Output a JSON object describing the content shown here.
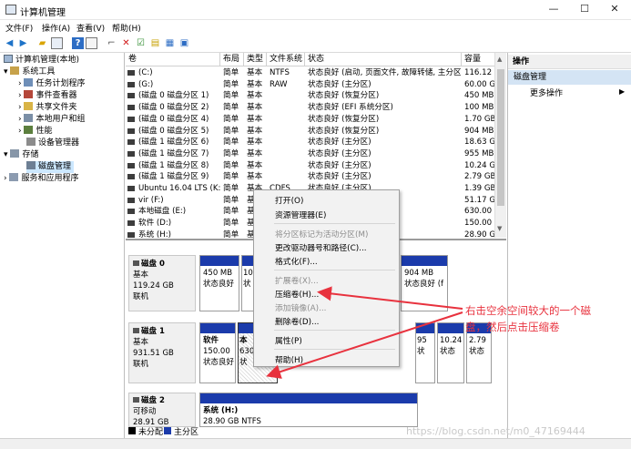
{
  "window": {
    "title": "计算机管理",
    "controls": [
      "—",
      "☐",
      "✕"
    ]
  },
  "menu": [
    "文件(F)",
    "操作(A)",
    "查看(V)",
    "帮助(H)"
  ],
  "toolbar_icons": [
    "back-icon",
    "forward-icon",
    "folder-up-icon",
    "console-tree-icon",
    "help-icon",
    "properties-icon",
    "connect-icon",
    "delete-icon",
    "check-icon",
    "new-icon",
    "refresh-icon",
    "export-icon"
  ],
  "tree": {
    "root": "计算机管理(本地)",
    "items": [
      {
        "label": "系统工具",
        "level": 1,
        "expander": "▾"
      },
      {
        "label": "任务计划程序",
        "level": 2,
        "expander": "›"
      },
      {
        "label": "事件查看器",
        "level": 2,
        "expander": "›"
      },
      {
        "label": "共享文件夹",
        "level": 2,
        "expander": "›"
      },
      {
        "label": "本地用户和组",
        "level": 2,
        "expander": "›"
      },
      {
        "label": "性能",
        "level": 2,
        "expander": "›"
      },
      {
        "label": "设备管理器",
        "level": 2,
        "expander": ""
      },
      {
        "label": "存储",
        "level": 1,
        "expander": "▾"
      },
      {
        "label": "磁盘管理",
        "level": 2,
        "expander": "",
        "selected": true
      },
      {
        "label": "服务和应用程序",
        "level": 1,
        "expander": "›"
      }
    ]
  },
  "volumes": {
    "headers": [
      "卷",
      "布局",
      "类型",
      "文件系统",
      "状态",
      "容量"
    ],
    "rows": [
      [
        "(C:)",
        "简单",
        "基本",
        "NTFS",
        "状态良好 (启动, 页面文件, 故障转储, 主分区)",
        "116.12 G"
      ],
      [
        "(G:)",
        "简单",
        "基本",
        "RAW",
        "状态良好 (主分区)",
        "60.00 GB"
      ],
      [
        "(磁盘 0 磁盘分区 1)",
        "简单",
        "基本",
        "",
        "状态良好 (恢复分区)",
        "450 MB"
      ],
      [
        "(磁盘 0 磁盘分区 2)",
        "简单",
        "基本",
        "",
        "状态良好 (EFI 系统分区)",
        "100 MB"
      ],
      [
        "(磁盘 0 磁盘分区 4)",
        "简单",
        "基本",
        "",
        "状态良好 (恢复分区)",
        "1.70 GB"
      ],
      [
        "(磁盘 0 磁盘分区 5)",
        "简单",
        "基本",
        "",
        "状态良好 (恢复分区)",
        "904 MB"
      ],
      [
        "(磁盘 1 磁盘分区 6)",
        "简单",
        "基本",
        "",
        "状态良好 (主分区)",
        "18.63 GB"
      ],
      [
        "(磁盘 1 磁盘分区 7)",
        "简单",
        "基本",
        "",
        "状态良好 (主分区)",
        "955 MB"
      ],
      [
        "(磁盘 1 磁盘分区 8)",
        "简单",
        "基本",
        "",
        "状态良好 (主分区)",
        "10.24 GB"
      ],
      [
        "(磁盘 1 磁盘分区 9)",
        "简单",
        "基本",
        "",
        "状态良好 (主分区)",
        "2.79 GB"
      ],
      [
        "Ubuntu 16.04 LTS (K:)",
        "简单",
        "基本",
        "CDFS",
        "状态良好 (主分区)",
        "1.39 GB"
      ],
      [
        "vir (F:)",
        "简单",
        "基",
        "",
        "",
        "51.17 GB"
      ],
      [
        "本地磁盘 (E:)",
        "简单",
        "基",
        "",
        "",
        "630.00 GB"
      ],
      [
        "软件 (D:)",
        "简单",
        "基",
        "",
        "",
        "150.00 GB"
      ],
      [
        "系统 (H:)",
        "简单",
        "基",
        "",
        "",
        "28.90 GB"
      ]
    ]
  },
  "actions": {
    "header": "操作",
    "sub": "磁盘管理",
    "more": "更多操作",
    "more_arrow": "▶"
  },
  "disks": [
    {
      "name": "磁盘 0",
      "type": "基本",
      "size": "119.24 GB",
      "state": "联机"
    },
    {
      "name": "磁盘 1",
      "type": "基本",
      "size": "931.51 GB",
      "state": "联机"
    },
    {
      "name": "磁盘 2",
      "type": "可移动",
      "size": "28.91 GB",
      "state": "联机"
    }
  ],
  "disk0_parts": [
    {
      "size": "450 MB",
      "status": "状态良好"
    },
    {
      "size": "10",
      "status": "状"
    },
    {
      "size": "904 MB",
      "status": "状态良好 (f"
    }
  ],
  "disk1_parts": [
    {
      "name": "软件",
      "size": "150.00",
      "status": "状态良好"
    },
    {
      "name": "本",
      "size": "630",
      "status": "状"
    },
    {
      "size": "95",
      "status": "状"
    },
    {
      "size": "10.24",
      "status": "状态"
    },
    {
      "size": "2.79",
      "status": "状态"
    }
  ],
  "disk2_part": {
    "name": "系统 (H:)",
    "size": "28.90 GB NTFS"
  },
  "legend": [
    "未分配",
    "主分区"
  ],
  "context_menu": {
    "items": [
      {
        "label": "打开(O)",
        "enabled": true
      },
      {
        "label": "资源管理器(E)",
        "enabled": true
      },
      {
        "label": "将分区标记为活动分区(M)",
        "enabled": false
      },
      {
        "label": "更改驱动器号和路径(C)...",
        "enabled": true
      },
      {
        "label": "格式化(F)...",
        "enabled": true
      },
      {
        "label": "扩展卷(X)...",
        "enabled": false
      },
      {
        "label": "压缩卷(H)...",
        "enabled": true
      },
      {
        "label": "添加镜像(A)...",
        "enabled": false
      },
      {
        "label": "删除卷(D)...",
        "enabled": true
      },
      {
        "label": "属性(P)",
        "enabled": true
      },
      {
        "label": "帮助(H)",
        "enabled": true
      }
    ]
  },
  "annotation": "右击空余空间较大的一个磁盘，然后点击压缩卷",
  "watermark": "https://blog.csdn.net/m0_47169444",
  "colors": {
    "partition_bar": "#1b3bab",
    "unallocated": "#000000",
    "primary": "#1b3bab",
    "annotation": "#e8323e",
    "selection": "#cce8ff"
  }
}
